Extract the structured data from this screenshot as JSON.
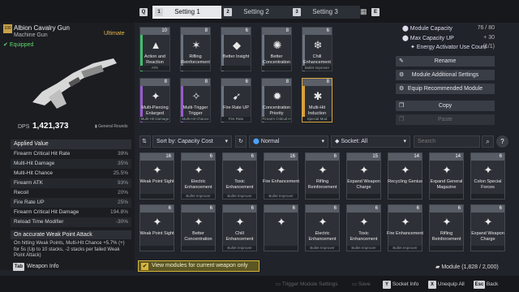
{
  "tabs": {
    "q_key": "Q",
    "e_key": "E",
    "items": [
      {
        "key": "1",
        "label": "Setting 1"
      },
      {
        "key": "2",
        "label": "Setting 2"
      },
      {
        "key": "3",
        "label": "Setting 3"
      }
    ]
  },
  "weapon": {
    "level": "100",
    "name": "Albion Cavalry Gun",
    "type": "Machine Gun",
    "rarity": "Ultimate",
    "status": "Equipped",
    "dps_label": "DPS",
    "dps_value": "1,421,373",
    "ammo": "General Rounds"
  },
  "stats": {
    "header": "Applied Value",
    "rows": [
      {
        "name": "Firearm Critical Hit Rate",
        "value": "39%"
      },
      {
        "name": "Multi-Hit Damage",
        "value": "35%"
      },
      {
        "name": "Multi-Hit Chance",
        "value": "25.5%"
      },
      {
        "name": "Firearm ATK",
        "value": "93%"
      },
      {
        "name": "Recoil",
        "value": "20%"
      },
      {
        "name": "Fire Rate UP",
        "value": "25%"
      },
      {
        "name": "Firearm Critical Hit Damage",
        "value": "194.8%"
      },
      {
        "name": "Reload Time Modifier",
        "value": "-30%"
      }
    ]
  },
  "weak_point": {
    "title": "On accurate Weak Point Attack",
    "desc": "On hitting Weak Points, Multi-Hit Chance +5.7% (+) for 5s (Up to 10 stacks, -2 stacks per failed Weak Point Attack)"
  },
  "weapon_info": {
    "key": "Tab",
    "label": "Weapon Info"
  },
  "equipped_slots": [
    {
      "cap": "10",
      "name": "Action and Reaction",
      "sub": "ATK",
      "color": "#3fbf6a",
      "icon": "▲"
    },
    {
      "cap": "8",
      "name": "Rifling Reinforcement",
      "sub": "",
      "color": "#6c7380",
      "icon": "✶"
    },
    {
      "cap": "6",
      "name": "Better Insight",
      "sub": "",
      "color": "#6c7380",
      "icon": "◆"
    },
    {
      "cap": "8",
      "name": "Better Concentration",
      "sub": "",
      "color": "#6c7380",
      "icon": "✺"
    },
    {
      "cap": "6",
      "name": "Chill Enhancement",
      "sub": "Bullet Improver",
      "color": "#6c7380",
      "icon": "❄"
    },
    {
      "cap": "8",
      "name": "Multi-Piercing Enlarged",
      "sub": "Multi-Hit Damage",
      "color": "#9b59d0",
      "icon": "✦"
    },
    {
      "cap": "8",
      "name": "Multi-Trigger Trigger",
      "sub": "Multi-Hit Chance",
      "color": "#9b59d0",
      "icon": "✧"
    },
    {
      "cap": "6",
      "name": "Fire Rate UP",
      "sub": "Fire Rate",
      "color": "#6c7380",
      "icon": "➹"
    },
    {
      "cap": "8",
      "name": "Concentration Priority",
      "sub": "Firearm Critical H",
      "color": "#6c7380",
      "icon": "✹"
    },
    {
      "cap": "8",
      "name": "Multi-Hit Induction",
      "sub": "Special Mod",
      "color": "#d8a038",
      "icon": "✱"
    }
  ],
  "right": {
    "capacity_label": "Module Capacity",
    "capacity_value": "76 / 80",
    "max_label": "Max Capacity UP",
    "max_value": "+ 30",
    "energy_label": "Energy Activator Use Count",
    "energy_value": "(1/1)",
    "buttons": [
      "Rename",
      "Module Additional Settings",
      "Equip Recommended Module",
      "Copy",
      "Paste"
    ]
  },
  "filter": {
    "sort": "Sort by: Capacity Cost",
    "mode": "Normal",
    "socket": "Socket: All",
    "search_placeholder": "Search"
  },
  "inventory": [
    {
      "cap": "16",
      "name": "Weak Point Sight",
      "sub": ""
    },
    {
      "cap": "6",
      "name": "Electric Enhancement",
      "sub": "Bullet Improver"
    },
    {
      "cap": "6",
      "name": "Toxic Enhancement",
      "sub": "Bullet Improver"
    },
    {
      "cap": "16",
      "name": "Fire Enhancement",
      "sub": "Bullet Improver"
    },
    {
      "cap": "6",
      "name": "Rifling Reinforcement",
      "sub": ""
    },
    {
      "cap": "15",
      "name": "Expand Weapon Charge",
      "sub": ""
    },
    {
      "cap": "14",
      "name": "Recycling Genius",
      "sub": ""
    },
    {
      "cap": "14",
      "name": "Expand General Magazine",
      "sub": ""
    },
    {
      "cap": "6",
      "name": "Colon Special Forces",
      "sub": ""
    },
    {
      "cap": "6",
      "name": "Weak Point Sight",
      "sub": ""
    },
    {
      "cap": "6",
      "name": "Better Concentration",
      "sub": ""
    },
    {
      "cap": "6",
      "name": "Chill Enhancement",
      "sub": "Bullet Improver"
    },
    {
      "cap": "6",
      "name": "",
      "sub": ""
    },
    {
      "cap": "6",
      "name": "Electric Enhancement",
      "sub": "Bullet Improver"
    },
    {
      "cap": "6",
      "name": "Toxic Enhancement",
      "sub": "Bullet Improver"
    },
    {
      "cap": "6",
      "name": "Fire Enhancement",
      "sub": "Bullet Improver"
    },
    {
      "cap": "6",
      "name": "Rifling Reinforcement",
      "sub": ""
    },
    {
      "cap": "6",
      "name": "Expand Weapon Charge",
      "sub": ""
    }
  ],
  "view_current": "View modules for current weapon only",
  "module_count": "Module (1,828 / 2,000)",
  "footer": [
    {
      "key": "",
      "label": "Trigger Module Settings",
      "disabled": true
    },
    {
      "key": "",
      "label": "Save",
      "disabled": true
    },
    {
      "key": "Y",
      "label": "Socket Info",
      "disabled": false
    },
    {
      "key": "X",
      "label": "Unequip All",
      "disabled": false
    },
    {
      "key": "Esc",
      "label": "Back",
      "disabled": false
    }
  ]
}
